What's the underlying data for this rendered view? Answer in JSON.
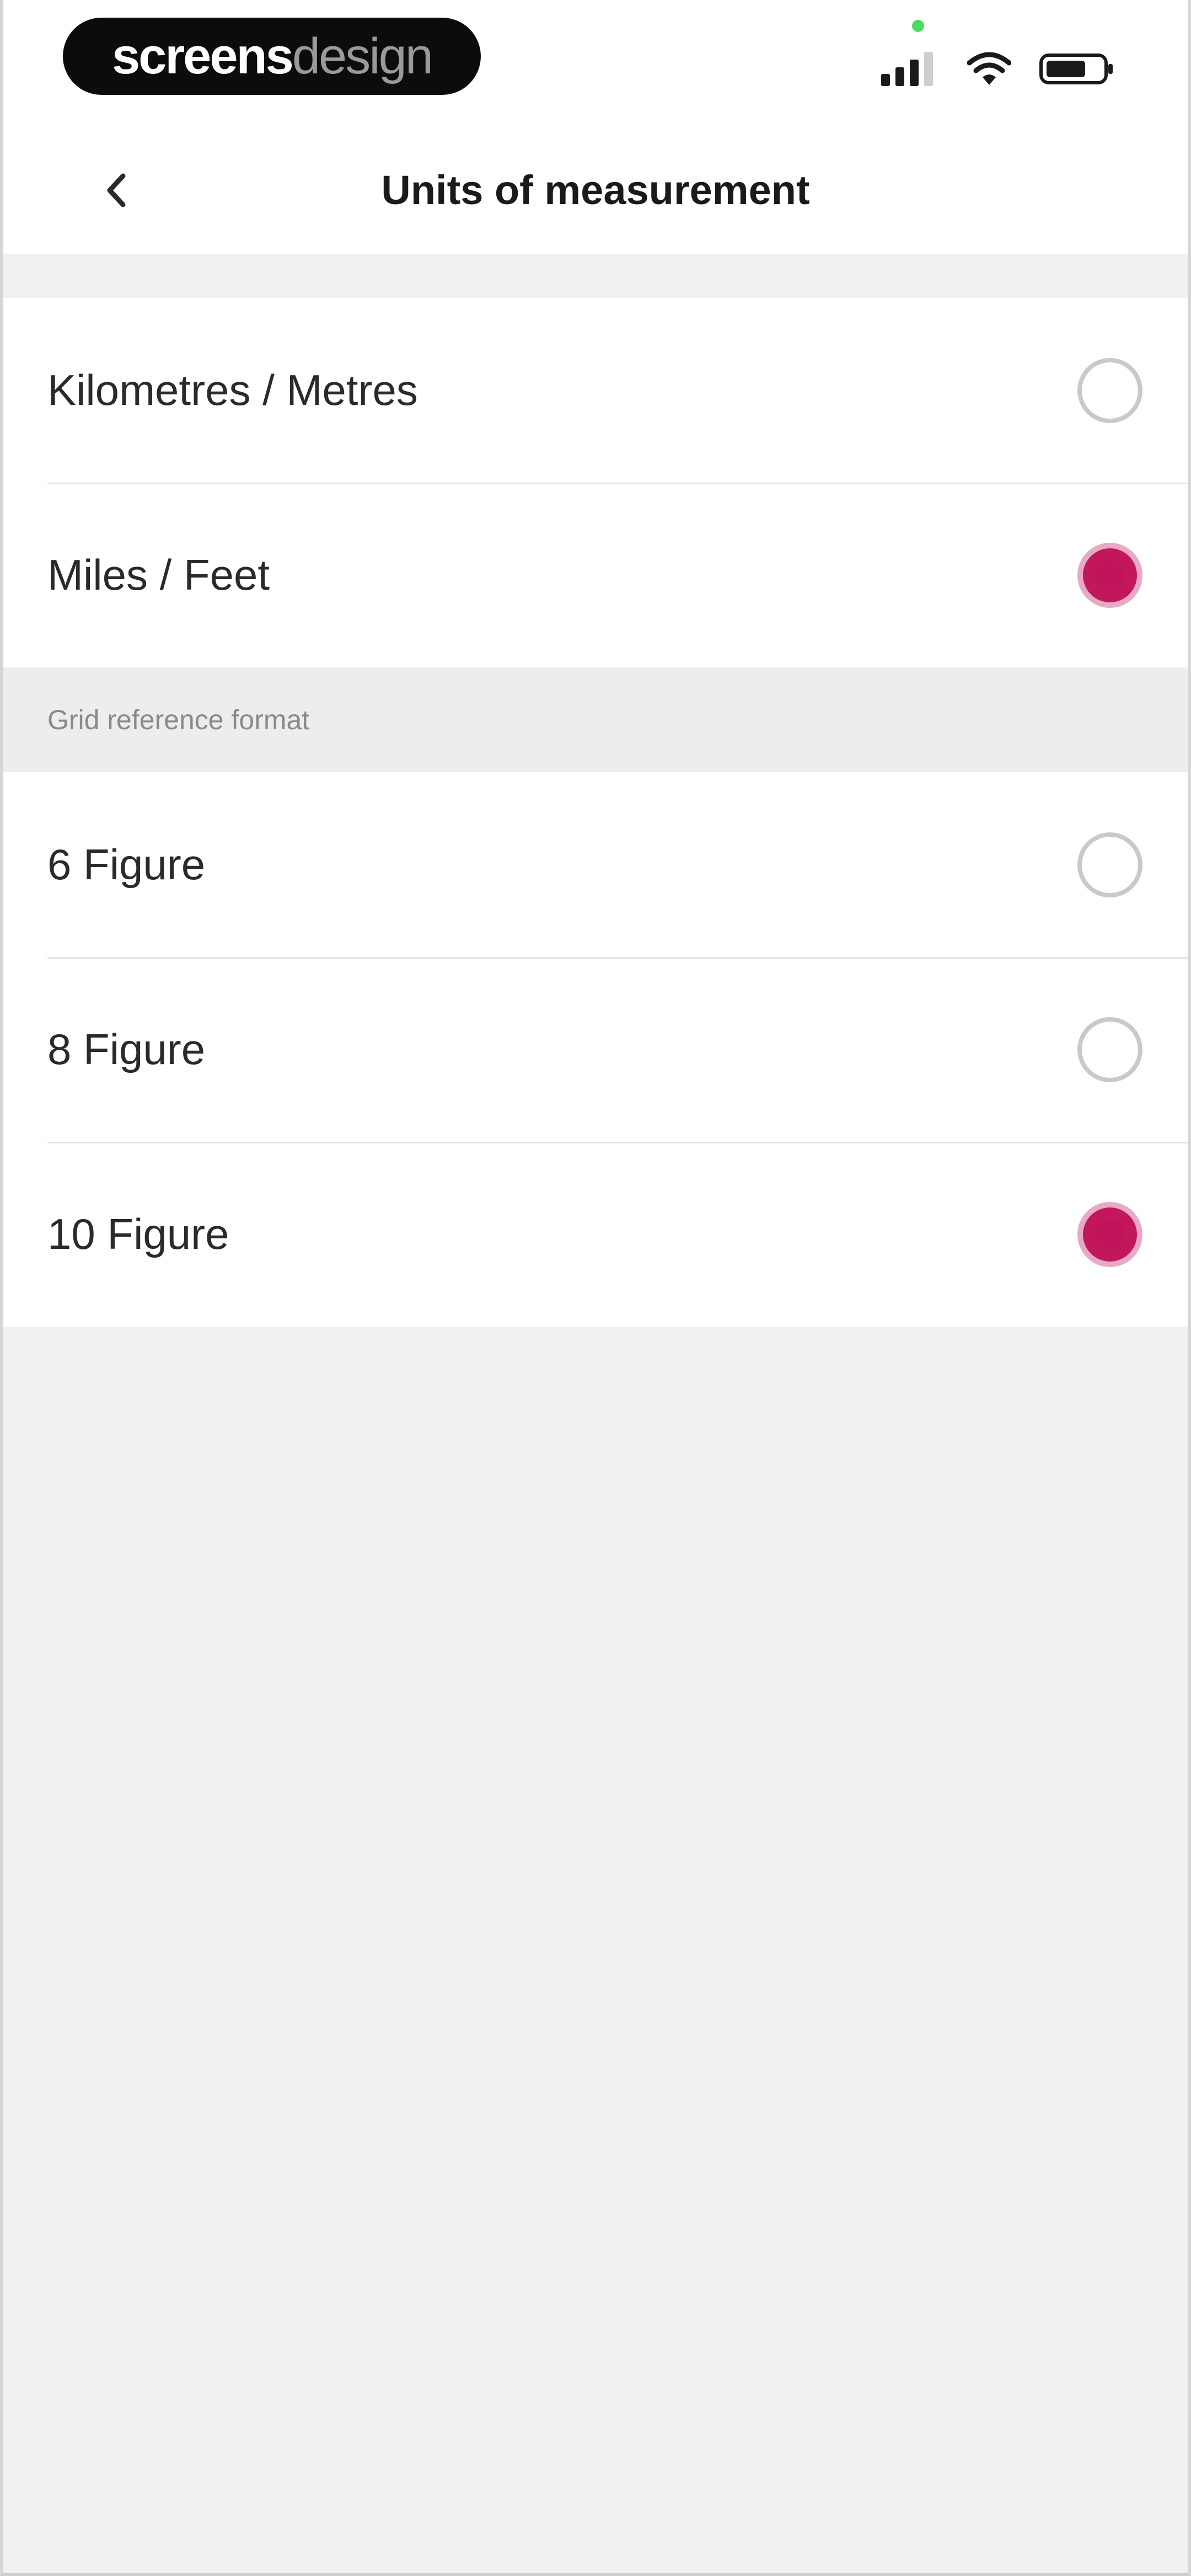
{
  "status_bar": {
    "brand_bold": "screens",
    "brand_light": "design",
    "icons": [
      "signal-icon",
      "wifi-icon",
      "battery-icon"
    ]
  },
  "header": {
    "title": "Units of measurement",
    "back_icon": "chevron-left-icon"
  },
  "units": {
    "options": [
      {
        "label": "Kilometres / Metres",
        "selected": false
      },
      {
        "label": "Miles / Feet",
        "selected": true
      }
    ]
  },
  "grid_reference": {
    "section_label": "Grid reference format",
    "options": [
      {
        "label": "6 Figure",
        "selected": false
      },
      {
        "label": "8 Figure",
        "selected": false
      },
      {
        "label": "10 Figure",
        "selected": true
      }
    ]
  },
  "colors": {
    "accent": "#c2185b",
    "background": "#f1f1f1",
    "surface": "#ffffff"
  }
}
